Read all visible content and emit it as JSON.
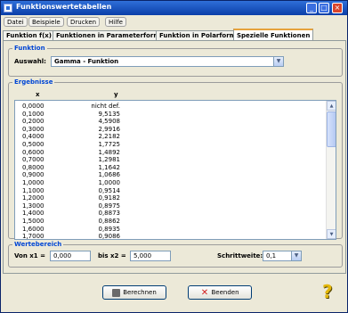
{
  "window": {
    "title": "Funktionswertetabellen"
  },
  "menu": [
    {
      "label": "Datei"
    },
    {
      "label": "Beispiele"
    },
    {
      "label": "Drucken"
    },
    {
      "label": "Hilfe"
    }
  ],
  "tabs": [
    {
      "label": "Funktion f(x)"
    },
    {
      "label": "Funktionen in Parameterform"
    },
    {
      "label": "Funktion in Polarform"
    },
    {
      "label": "Spezielle Funktionen"
    }
  ],
  "funktion": {
    "legend": "Funktion",
    "auswahl_label": "Auswahl:",
    "auswahl_value": "Gamma - Funktion"
  },
  "ergebnisse": {
    "legend": "Ergebnisse",
    "col_x": "x",
    "col_y": "y",
    "rows": [
      {
        "x": "0,0000",
        "y": "nicht def."
      },
      {
        "x": "0,1000",
        "y": "9,5135"
      },
      {
        "x": "0,2000",
        "y": "4,5908"
      },
      {
        "x": "0,3000",
        "y": "2,9916"
      },
      {
        "x": "0,4000",
        "y": "2,2182"
      },
      {
        "x": "0,5000",
        "y": "1,7725"
      },
      {
        "x": "0,6000",
        "y": "1,4892"
      },
      {
        "x": "0,7000",
        "y": "1,2981"
      },
      {
        "x": "0,8000",
        "y": "1,1642"
      },
      {
        "x": "0,9000",
        "y": "1,0686"
      },
      {
        "x": "1,0000",
        "y": "1,0000"
      },
      {
        "x": "1,1000",
        "y": "0,9514"
      },
      {
        "x": "1,2000",
        "y": "0,9182"
      },
      {
        "x": "1,3000",
        "y": "0,8975"
      },
      {
        "x": "1,4000",
        "y": "0,8873"
      },
      {
        "x": "1,5000",
        "y": "0,8862"
      },
      {
        "x": "1,6000",
        "y": "0,8935"
      },
      {
        "x": "1,7000",
        "y": "0,9086"
      }
    ]
  },
  "wertebereich": {
    "legend": "Wertebereich",
    "x1_label": "Von x1 =",
    "x1_value": "0,000",
    "x2_label": "bis x2 =",
    "x2_value": "5,000",
    "schrittweite_label": "Schrittweite:",
    "schrittweite_value": "0,1"
  },
  "buttons": {
    "berechnen": "Berechnen",
    "beenden": "Beenden"
  },
  "help_symbol": "?"
}
